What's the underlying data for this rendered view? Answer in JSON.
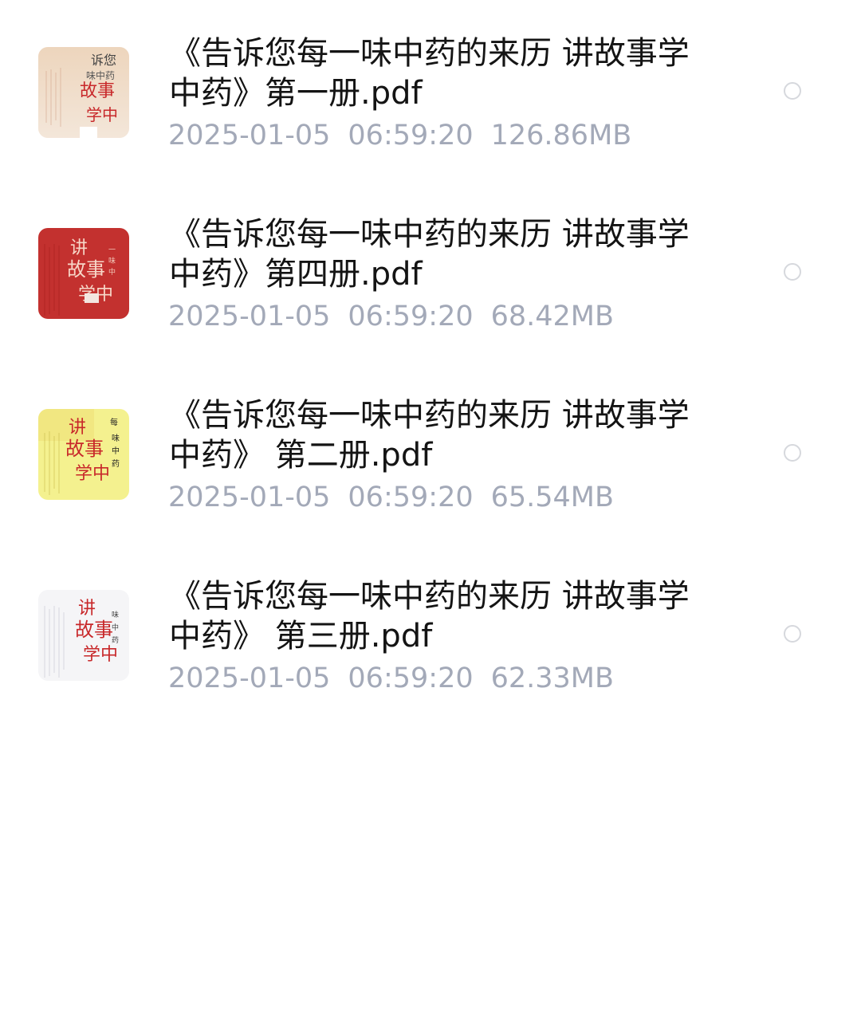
{
  "files": [
    {
      "title_line1": "《告诉您每一味中药的来历 讲故事学",
      "title_line2": "中药》第一册.pdf",
      "date": "2025-01-05",
      "time": "06:59:20",
      "size": "126.86MB",
      "thumbnail_icon": "book-cover-thumbnail",
      "cover_color": "#f0e0d0",
      "selected": false
    },
    {
      "title_line1": "《告诉您每一味中药的来历 讲故事学",
      "title_line2": "中药》第四册.pdf",
      "date": "2025-01-05",
      "time": "06:59:20",
      "size": "68.42MB",
      "thumbnail_icon": "book-cover-thumbnail",
      "cover_color": "#c3312f",
      "selected": false
    },
    {
      "title_line1": "《告诉您每一味中药的来历 讲故事学",
      "title_line2": "中药》 第二册.pdf",
      "date": "2025-01-05",
      "time": "06:59:20",
      "size": "65.54MB",
      "thumbnail_icon": "book-cover-thumbnail",
      "cover_color": "#f3ef8e",
      "selected": false
    },
    {
      "title_line1": "《告诉您每一味中药的来历  讲故事学",
      "title_line2": "中药》 第三册.pdf",
      "date": "2025-01-05",
      "time": "06:59:20",
      "size": "62.33MB",
      "thumbnail_icon": "book-cover-thumbnail",
      "cover_color": "#f4f4f6",
      "selected": false
    }
  ],
  "colors": {
    "title_text": "#141414",
    "meta_text": "#a3a9b8",
    "radio_border": "#d6d8dd",
    "cover_red_ink": "#c8282a"
  }
}
